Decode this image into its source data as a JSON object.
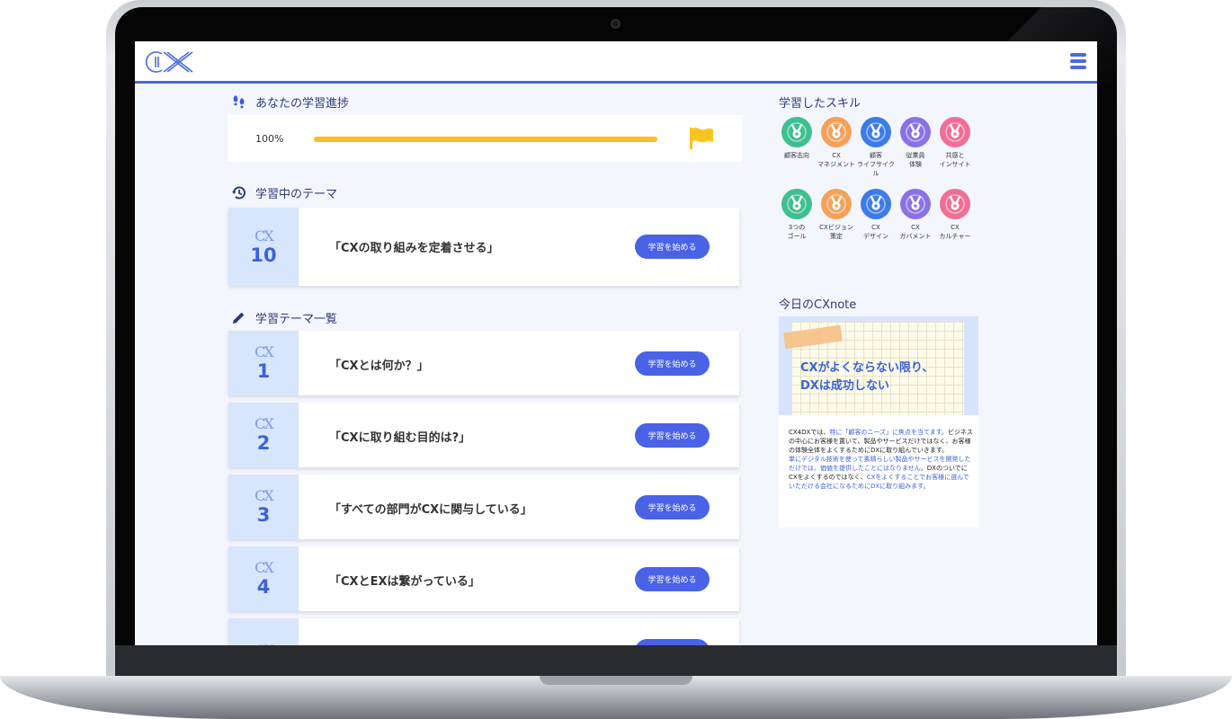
{
  "app": {
    "logo_text": "CX"
  },
  "progress": {
    "section_title": "あなたの学習進捗",
    "percent_label": "100%",
    "percent_value": 100
  },
  "current": {
    "section_title": "学習中のテーマ",
    "item": {
      "brand": "CX",
      "number": "10",
      "title": "「CXの取り組みを定着させる」",
      "button": "学習を始める"
    }
  },
  "list": {
    "section_title": "学習テーマ一覧",
    "items": [
      {
        "brand": "CX",
        "number": "1",
        "title": "「CXとは何か？」",
        "button": "学習を始める"
      },
      {
        "brand": "CX",
        "number": "2",
        "title": "「CXに取り組む目的は?」",
        "button": "学習を始める"
      },
      {
        "brand": "CX",
        "number": "3",
        "title": "「すべての部門がCXに関与している」",
        "button": "学習を始める"
      },
      {
        "brand": "CX",
        "number": "4",
        "title": "「CXとEXは繋がっている」",
        "button": "学習を始める"
      },
      {
        "brand": "CX",
        "number": "",
        "title": "",
        "button": ""
      }
    ]
  },
  "skills": {
    "section_title": "学習したスキル",
    "row1": [
      {
        "label": "顧客志向",
        "color": "#3fbf8f"
      },
      {
        "label": "CX\nマネジメント",
        "color": "#f4a15a"
      },
      {
        "label": "顧客\nライフサイク\nル",
        "color": "#3d7be8"
      },
      {
        "label": "従業員\n体験",
        "color": "#8a72e6"
      },
      {
        "label": "共感と\nインサイト",
        "color": "#ef6f96"
      }
    ],
    "row2": [
      {
        "label": "3つの\nゴール",
        "color": "#3fbf8f"
      },
      {
        "label": "CXビジョン\n策定",
        "color": "#f4a15a"
      },
      {
        "label": "CX\nデザイン",
        "color": "#3d7be8"
      },
      {
        "label": "CX\nガバメント",
        "color": "#8a72e6"
      },
      {
        "label": "CX\nカルチャー",
        "color": "#ef6f96"
      }
    ]
  },
  "note": {
    "section_title": "今日のCXnote",
    "headline": "CXがよくならない限り、\nDXは成功しない",
    "body_1": "CX4DXでは、",
    "body_2": "特に「顧客のニーズ」に焦点を当てます。",
    "body_3": "ビジネスの中心にお客様を置いて、製品やサービスだけではなく、お客様の体験全体をよくするためにDXに取り組んでいきます。",
    "body_4": "単にデジタル技術を使って素晴らしい製品やサービスを開発しただけでは、価値を提供したことにはなりません。",
    "body_5": "DXのついでにCXをよくするのではなく、",
    "body_6": "CXをよくすることでお客様に選んでいただける会社になるためにDXに取り組みます。"
  },
  "colors": {
    "accent": "#4a62e6",
    "progress": "#f7bd2b",
    "theme_bg": "#d8e6fd"
  }
}
